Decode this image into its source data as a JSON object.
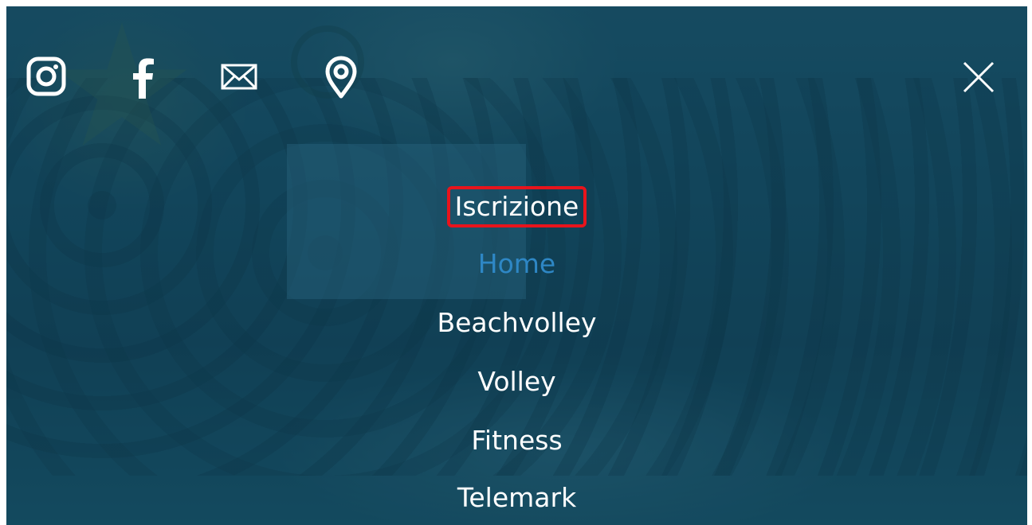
{
  "social": {
    "icons": [
      "instagram-icon",
      "facebook-icon",
      "mail-icon",
      "location-pin-icon"
    ]
  },
  "close": {
    "icon": "close-icon"
  },
  "menu": {
    "items": [
      {
        "label": "Iscrizione",
        "state": "highlighted"
      },
      {
        "label": "Home",
        "state": "active"
      },
      {
        "label": "Beachvolley",
        "state": "normal"
      },
      {
        "label": "Volley",
        "state": "normal"
      },
      {
        "label": "Fitness",
        "state": "normal"
      },
      {
        "label": "Telemark",
        "state": "normal"
      }
    ]
  },
  "colors": {
    "overlay": "#0e4258",
    "active_link": "#2e87c5",
    "highlight_border": "#e8141c",
    "text": "#ffffff"
  }
}
